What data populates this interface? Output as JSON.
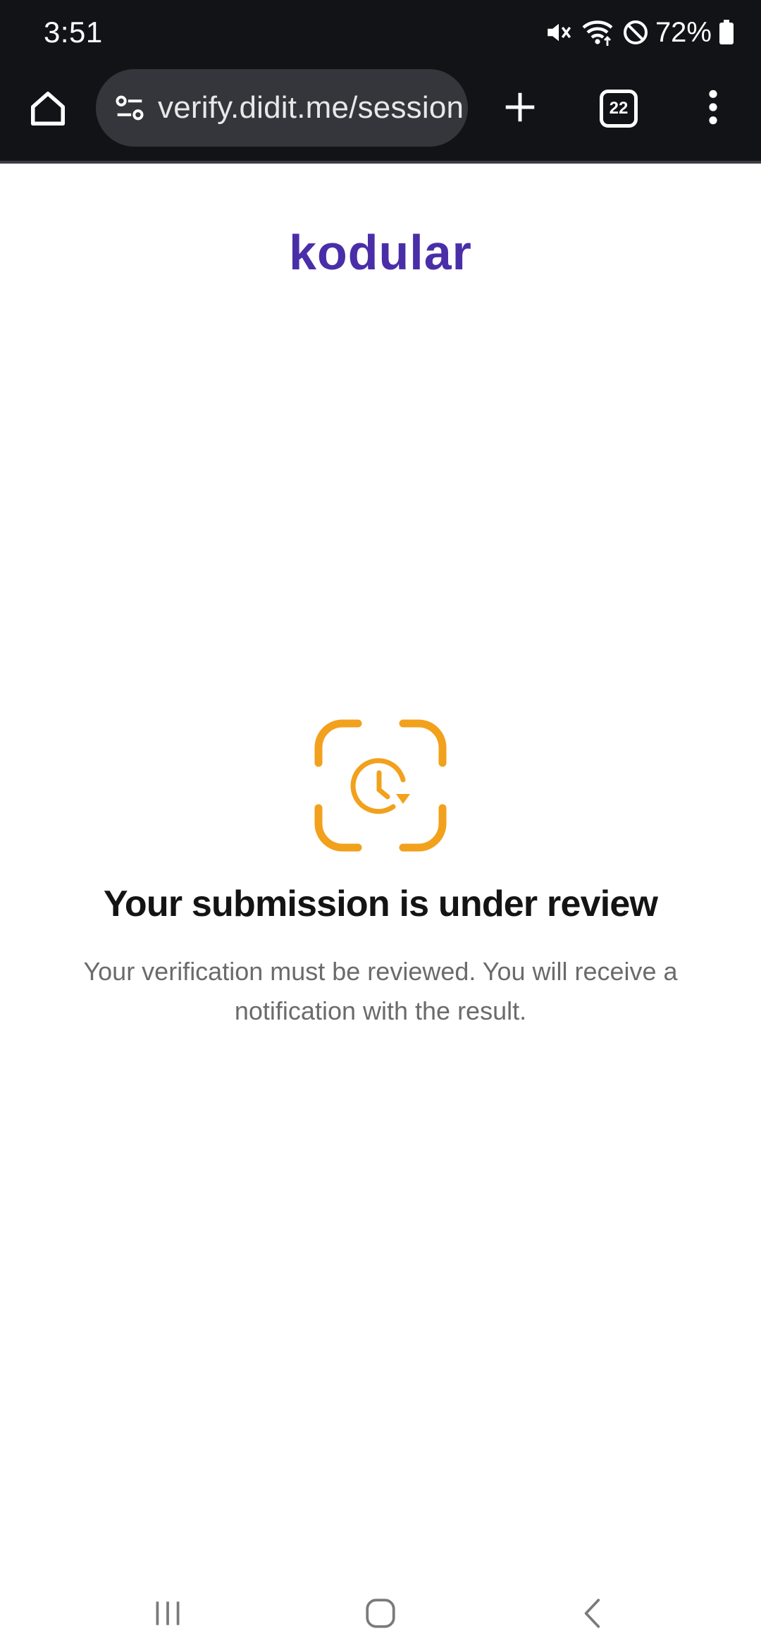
{
  "status_bar": {
    "time": "3:51",
    "battery_percent": "72%",
    "icons": [
      "mute-icon",
      "wifi-icon",
      "dnd-icon",
      "battery-icon"
    ]
  },
  "browser": {
    "url": "verify.didit.me/session",
    "tab_count": "22",
    "icons": [
      "home-icon",
      "site-settings-icon",
      "plus-icon",
      "tab-switcher-icon",
      "more-vert-icon"
    ]
  },
  "page": {
    "logo_text": "kodular",
    "heading": "Your submission is under review",
    "message": "Your verification must be reviewed. You will receive a notification with the result."
  },
  "nav_bar": {
    "icons": [
      "recents-icon",
      "home-nav-icon",
      "back-icon"
    ]
  },
  "colors": {
    "brand": "#4a2ea8",
    "accent": "#f2a11c",
    "chrome_bg": "#121316",
    "url_bar_bg": "#35363b"
  }
}
